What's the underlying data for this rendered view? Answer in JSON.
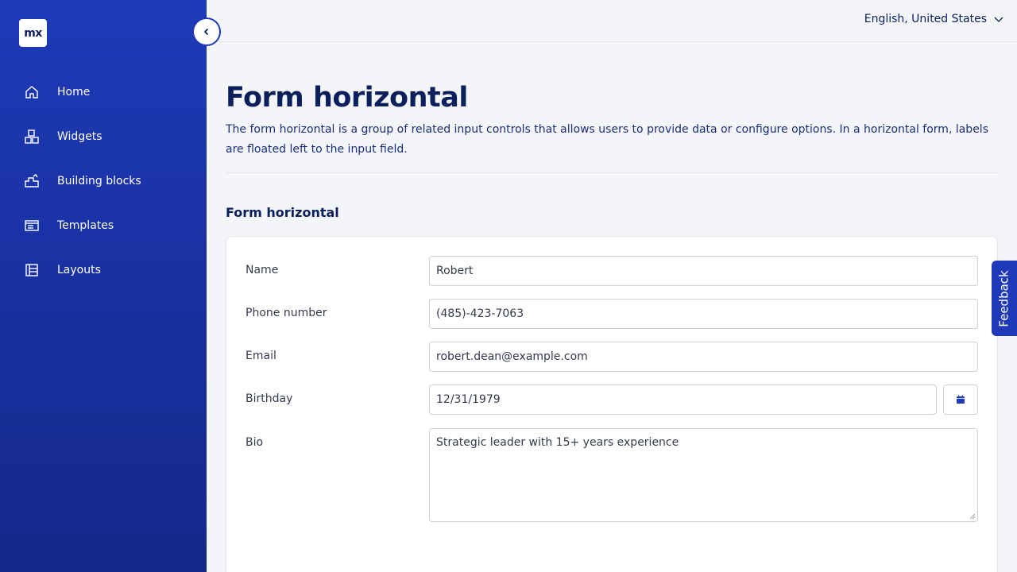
{
  "app": {
    "logo_text": "mx"
  },
  "sidebar": {
    "items": [
      {
        "label": "Home",
        "icon": "home-icon"
      },
      {
        "label": "Widgets",
        "icon": "widgets-icon"
      },
      {
        "label": "Building blocks",
        "icon": "building-blocks-icon"
      },
      {
        "label": "Templates",
        "icon": "templates-icon"
      },
      {
        "label": "Layouts",
        "icon": "layouts-icon"
      }
    ],
    "collapse_icon": "chevron-left-icon"
  },
  "header": {
    "language": "English, United States",
    "language_icon": "chevron-down-icon"
  },
  "page": {
    "title": "Form horizontal",
    "description": "The form horizontal is a group of related input controls that allows users to provide data or configure options. In a horizontal form, labels are floated left to the input field.",
    "section_title": "Form horizontal"
  },
  "form": {
    "name_label": "Name",
    "name_value": "Robert",
    "phone_label": "Phone number",
    "phone_value": "(485)-423-7063",
    "email_label": "Email",
    "email_value": "robert.dean@example.com",
    "birthday_label": "Birthday",
    "birthday_value": "12/31/1979",
    "birthday_icon": "calendar-icon",
    "bio_label": "Bio",
    "bio_value": "Strategic leader with 15+ years experience"
  },
  "feedback": {
    "label": "Feedback"
  },
  "colors": {
    "brand": "#1e3ab8",
    "brand_dark": "#14288a",
    "heading": "#0a1f5c",
    "background": "#f4f5f9"
  }
}
